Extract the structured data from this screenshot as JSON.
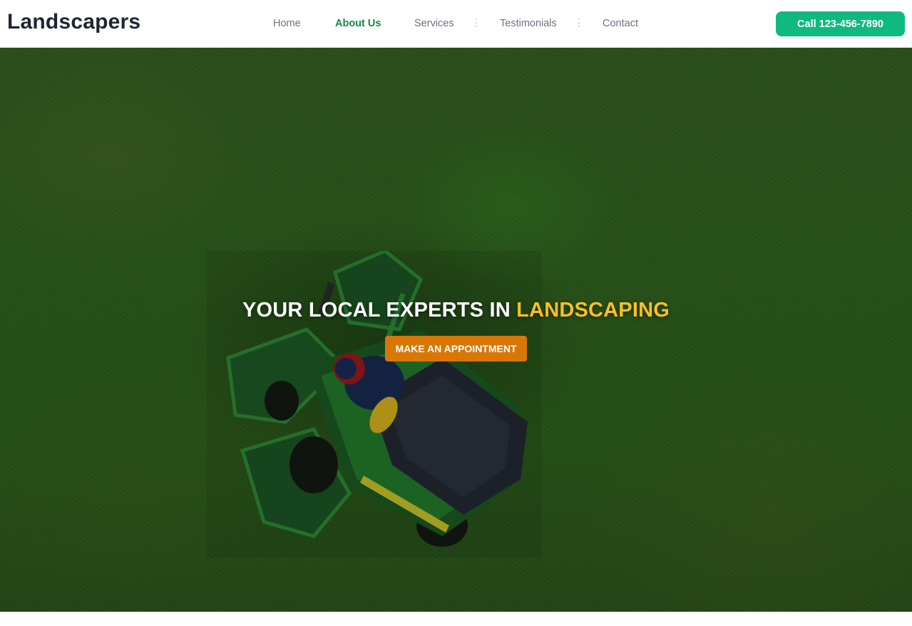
{
  "brand": {
    "name": "Landscapers"
  },
  "nav": {
    "items": [
      {
        "label": "Home",
        "active": false
      },
      {
        "label": "About Us",
        "active": true
      },
      {
        "label": "Services",
        "active": false
      },
      {
        "label": "Testimonials",
        "active": false
      },
      {
        "label": "Contact",
        "active": false
      }
    ]
  },
  "header": {
    "call_label": "Call 123-456-7890"
  },
  "hero": {
    "title_prefix": "YOUR LOCAL EXPERTS IN",
    "title_accent": "LANDSCAPING",
    "cta_label": "MAKE AN APPOINTMENT",
    "background_image": "aerial view of ride-on lawn mower on grass"
  },
  "colors": {
    "brand_green": "#10b97f",
    "active_nav": "#0f8a4c",
    "accent_yellow": "#fbbf24",
    "cta_orange": "#d97706",
    "logo_text": "#1f2532"
  },
  "icons": [
    "nav-divider-icon"
  ]
}
